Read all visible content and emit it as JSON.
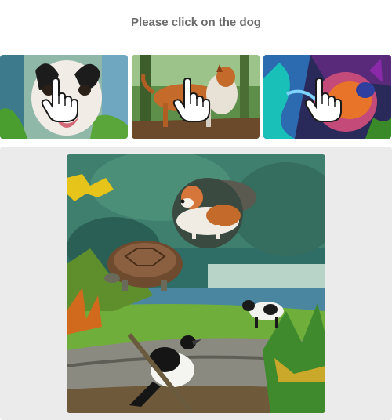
{
  "instruction": "Please click on the dog",
  "thumbnails": [
    {
      "icon": "pointer-hand-icon",
      "subject": "dog-painting"
    },
    {
      "icon": "pointer-hand-icon",
      "subject": "dog-painting"
    },
    {
      "icon": "pointer-hand-icon",
      "subject": "dog-painting"
    }
  ],
  "scene": {
    "subjects": [
      "dog",
      "tortoise",
      "cow",
      "magpie"
    ]
  },
  "colors": {
    "title": "#6b6b6b",
    "panel_background": "#ebebeb",
    "page_background": "#ffffff"
  }
}
